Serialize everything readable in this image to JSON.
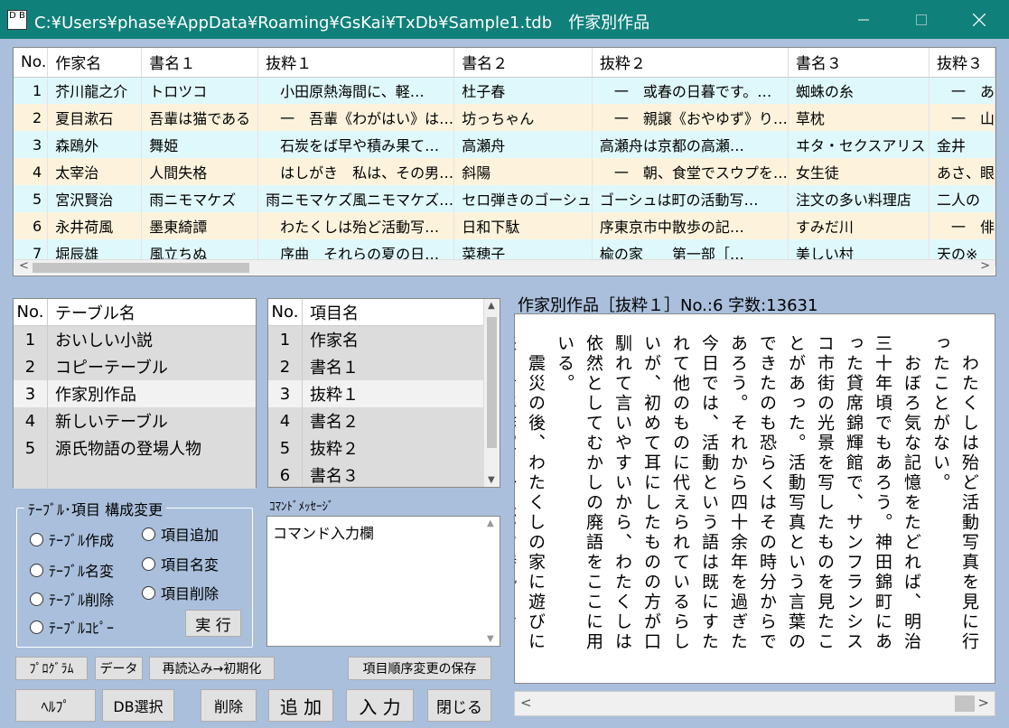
{
  "window": {
    "title": "C:¥Users¥phase¥AppData¥Roaming¥GsKai¥TxDb¥Sample1.tdb　作家別作品",
    "icon_label": "D B"
  },
  "grid": {
    "columns": [
      "No.",
      "作家名",
      "書名１",
      "抜粋１",
      "書名２",
      "抜粋２",
      "書名３",
      "抜粋３"
    ],
    "rows": [
      [
        "1",
        "芥川龍之介",
        "トロツコ",
        "　小田原熱海間に、軽…",
        "杜子春",
        "　一　或春の日暮です。…",
        "蜘蛛の糸",
        "　一　あ"
      ],
      [
        "2",
        "夏目漱石",
        "吾輩は猫である",
        "　一　吾輩《わがはい》は…",
        "坊っちゃん",
        "　一　親譲《おやゆず》り…",
        "草枕",
        "　一　山"
      ],
      [
        "3",
        "森鴎外",
        "舞姫",
        "　石炭をば早や積み果て…",
        "高瀬舟",
        "高瀬舟は京都の高瀬…",
        "ヰタ・セクスアリス",
        "金井"
      ],
      [
        "4",
        "太宰治",
        "人間失格",
        "　はしがき　私は、その男…",
        "斜陽",
        "　一　朝、食堂でスウプを…",
        "女生徒",
        "あさ、眼"
      ],
      [
        "5",
        "宮沢賢治",
        "雨ニモマケズ",
        "雨ニモマケズ風ニモマケズ…",
        "セロ弾きのゴーシュ",
        "ゴーシュは町の活動写…",
        "注文の多い料理店",
        "二人の"
      ],
      [
        "6",
        "永井荷風",
        "墨東綺譚",
        "　わたくしは殆ど活動写…",
        "日和下駄",
        "序東京市中散歩の記…",
        "すみだ川",
        "　一　俳"
      ],
      [
        "7",
        "堀辰雄",
        "風立ちぬ",
        "　序曲　それらの夏の日…",
        "菜穂子",
        "楡の家　　第一部［…",
        "美しい村",
        "天の※"
      ]
    ]
  },
  "tables": {
    "header_no": "No.",
    "header_name": "テーブル名",
    "items": [
      {
        "no": "1",
        "name": "おいしい小説"
      },
      {
        "no": "2",
        "name": "コピーテーブル"
      },
      {
        "no": "3",
        "name": "作家別作品"
      },
      {
        "no": "4",
        "name": "新しいテーブル"
      },
      {
        "no": "5",
        "name": "源氏物語の登場人物"
      }
    ],
    "selected_index": 2
  },
  "fields": {
    "header_no": "No.",
    "header_name": "項目名",
    "items": [
      {
        "no": "1",
        "name": "作家名"
      },
      {
        "no": "2",
        "name": "書名１"
      },
      {
        "no": "3",
        "name": "抜粋１"
      },
      {
        "no": "4",
        "name": "書名２"
      },
      {
        "no": "5",
        "name": "抜粋２"
      },
      {
        "no": "6",
        "name": "書名３"
      }
    ],
    "selected_index": 2
  },
  "config": {
    "legend": "ﾃｰﾌﾞﾙ･項目 構成変更",
    "create_table": "ﾃｰﾌﾞﾙ作成",
    "rename_table": "ﾃｰﾌﾞﾙ名変",
    "delete_table": "ﾃｰﾌﾞﾙ削除",
    "copy_table": "ﾃｰﾌﾞﾙｺﾋﾟｰ",
    "add_field": "項目追加",
    "rename_field": "項目名変",
    "delete_field": "項目削除",
    "execute": "実 行"
  },
  "command": {
    "label": "ｺﾏﾝﾄﾞﾒｯｾｰｼﾞ",
    "text": "コマンド入力欄"
  },
  "buttons": {
    "program": "ﾌﾟﾛｸﾞﾗﾑ",
    "data": "データ",
    "reload": "再読込み→初期化",
    "save_order": "項目順序変更の保存",
    "help": "ﾍﾙﾌﾟ",
    "db_select": "DB選択",
    "delete": "削除",
    "add": "追 加",
    "input": "入 力",
    "close": "閉じる"
  },
  "reader": {
    "title": "作家別作品［抜粋１］No.:6 字数:13631",
    "text": "　わたくしは殆ど活動写真を見に行ったことがない。\n　おぼろ気な記憶をたどれば、明治三十年頃でもあろう。神田錦町にあった貸席錦輝館で、サンフランシスコ市街の光景を写したものを見たことがあった。活動写真という言葉のできたのも恐らくはその時分からであろう。それから四十余年を過ぎた今日では、活動という語は既にすたれて他のものに代えられているらしいが、初めて耳にしたものの方が口馴れて言いやすいから、わたくしは依然としてむかしの廃語をここに用いる。\n　震災の後、わたくしの家に遊びに来た青年作家の一人が、時勢におくれるからと"
  },
  "colors": {
    "titlebar": "#10807a",
    "background": "#a9bfdc",
    "row_odd": "#dff8fb",
    "row_even": "#fdf3dc"
  }
}
